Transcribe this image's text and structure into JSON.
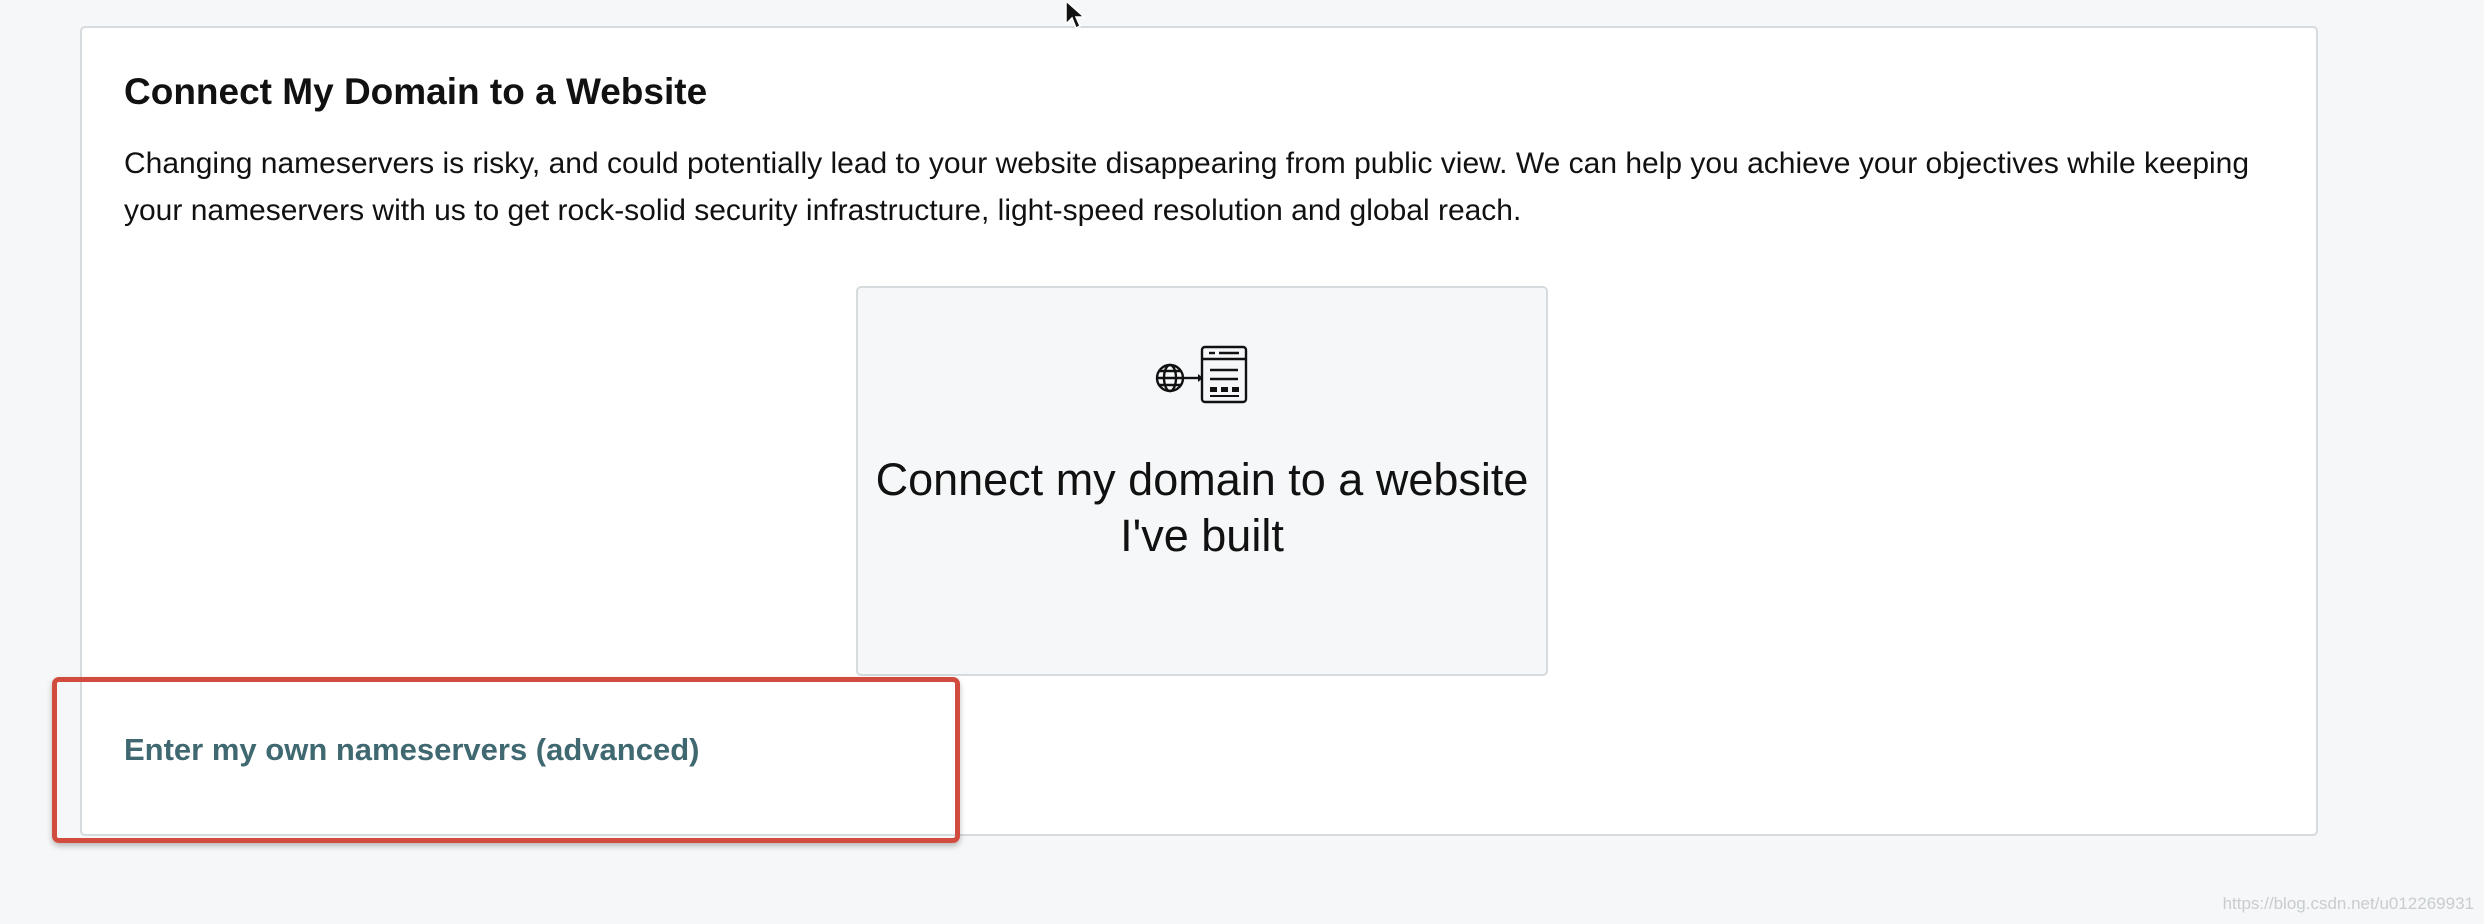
{
  "panel": {
    "title": "Connect My Domain to a Website",
    "description": "Changing nameservers is risky, and could potentially lead to your website disappearing from public view. We can help you achieve your objectives while keeping your nameservers with us to get rock-solid security infrastructure, light-speed resolution and global reach."
  },
  "option_card": {
    "icon": "globe-to-website-icon",
    "label": "Connect my domain to a website I've built"
  },
  "advanced_link": {
    "label": "Enter my own nameservers (advanced)"
  },
  "annotation": {
    "highlight_color": "#d24b3f"
  },
  "colors": {
    "background": "#f5f7f8",
    "panel": "#ffffff",
    "link": "#3f6870"
  },
  "watermark": "https://blog.csdn.net/u012269931"
}
